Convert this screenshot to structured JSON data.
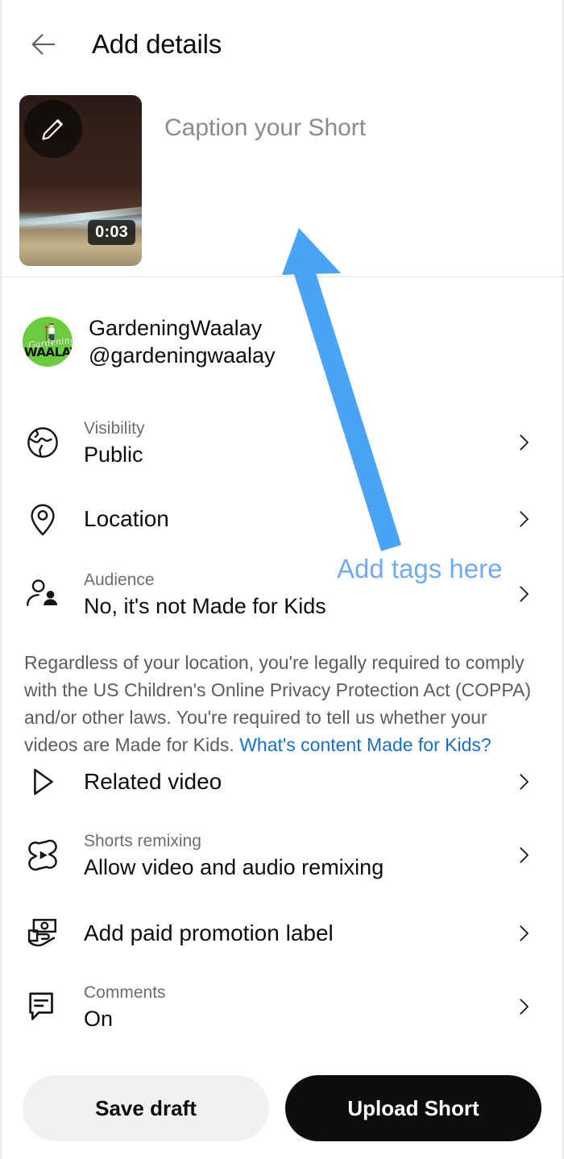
{
  "header": {
    "title": "Add details",
    "back_icon": "back-arrow-icon"
  },
  "caption": {
    "placeholder": "Caption your Short",
    "duration": "0:03",
    "edit_icon": "pencil-icon"
  },
  "channel": {
    "name": "GardeningWaalay",
    "handle": "@gardeningwaalay",
    "avatar_script": "Gardening",
    "avatar_bold": "WAALAY",
    "avatar_color": "#6dcb3f"
  },
  "rows": [
    {
      "key": "visibility",
      "icon": "globe-icon",
      "label": "Visibility",
      "value": "Public"
    },
    {
      "key": "location",
      "icon": "location-pin-icon",
      "value": "Location"
    },
    {
      "key": "audience",
      "icon": "audience-people-icon",
      "label": "Audience",
      "value": "No, it's not Made for Kids"
    },
    {
      "key": "related_video",
      "icon": "play-triangle-icon",
      "value": "Related video"
    },
    {
      "key": "shorts_remixing",
      "icon": "shorts-remix-icon",
      "label": "Shorts remixing",
      "value": "Allow video and audio remixing"
    },
    {
      "key": "paid_promotion",
      "icon": "paid-promotion-icon",
      "value": "Add paid promotion label"
    },
    {
      "key": "comments",
      "icon": "comment-bubble-icon",
      "label": "Comments",
      "value": "On"
    }
  ],
  "coppa": {
    "text": "Regardless of your location, you're legally required to comply with the US Children's Online Privacy Protection Act (COPPA) and/or other laws. You're required to tell us whether your videos are Made for Kids. ",
    "link": "What's content Made for Kids?",
    "link_color": "#1a6fc4"
  },
  "footer": {
    "save_draft": "Save draft",
    "upload_short": "Upload Short"
  },
  "annotation": {
    "text": "Add tags here",
    "color": "#4aa3f5",
    "text_color": "#74aaf5",
    "arrow": "blue-arrow-annotation"
  }
}
